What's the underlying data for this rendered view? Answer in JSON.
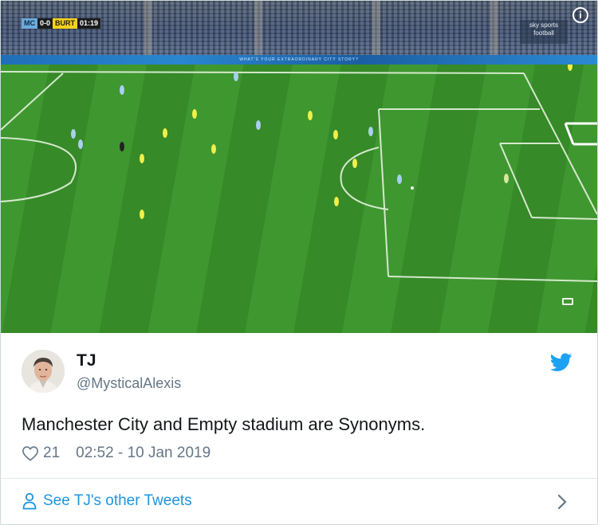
{
  "media": {
    "scoreboard": {
      "home": "MC",
      "score": "0-0",
      "away": "BURT",
      "clock": "01:19"
    },
    "channel_logo": [
      "sky sports",
      "football"
    ],
    "adboard_text": "WHAT'S YOUR EXTRAORDINARY CITY STORY?",
    "info_glyph": "i",
    "icons": [
      "info-icon",
      "expand-icon"
    ]
  },
  "tweet": {
    "author_name": "TJ",
    "author_handle": "@MysticalAlexis",
    "text": "Manchester City and Empty stadium are Synonyms.",
    "likes": "21",
    "timestamp": "02:52 - 10 Jan 2019",
    "see_more": "See TJ's other Tweets",
    "icons": [
      "twitter-bird-icon",
      "heart-icon",
      "person-icon",
      "chevron-right-icon"
    ]
  },
  "colors": {
    "twitter_blue": "#1da1f2",
    "link_blue": "#1b95e0",
    "secondary_text": "#657786",
    "pitch_green": "#3f9730"
  }
}
